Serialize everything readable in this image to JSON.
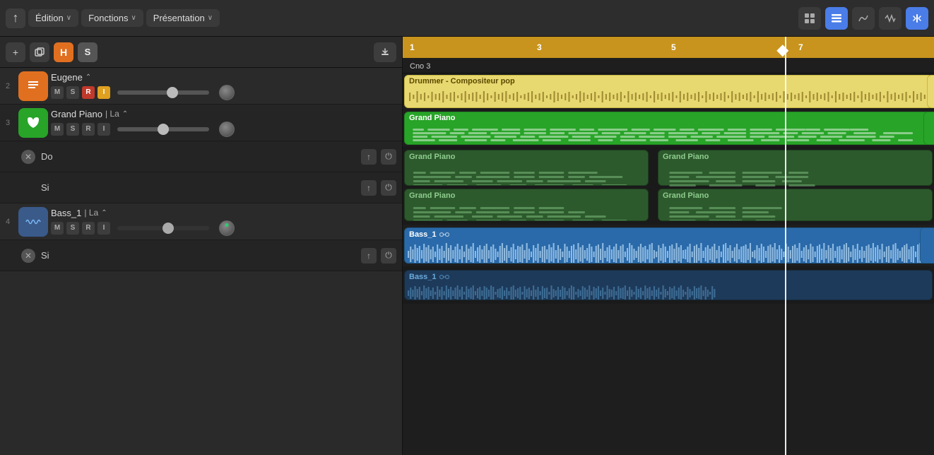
{
  "toolbar": {
    "back_label": "↑",
    "edition_label": "Édition",
    "fonctions_label": "Fonctions",
    "presentation_label": "Présentation",
    "chevron": "∨",
    "icons": {
      "grid": "⊞",
      "list": "≡",
      "curve": "∿",
      "wave": "∿",
      "split": "⊣"
    }
  },
  "track_controls": {
    "add_label": "+",
    "duplicate_label": "⧉",
    "h_label": "H",
    "s_label": "S",
    "import_label": "⬇"
  },
  "tracks": [
    {
      "number": "2",
      "icon_type": "orange",
      "icon_glyph": "♩",
      "name": "Eugene",
      "detail": "",
      "has_chevron": true,
      "controls": [
        "M",
        "S",
        "R",
        "I"
      ],
      "r_active": true,
      "slider_pos": "60%",
      "show_knob": true
    },
    {
      "number": "3",
      "icon_type": "green",
      "icon_glyph": "♪",
      "name": "Grand Piano",
      "detail": "| La",
      "has_chevron": true,
      "controls": [
        "M",
        "S",
        "R",
        "I"
      ],
      "slider_pos": "50%",
      "show_knob": true
    },
    {
      "number": "4",
      "icon_type": "blue-wave",
      "icon_glyph": "≋",
      "name": "Bass_1",
      "detail": "| La",
      "has_chevron": true,
      "controls": [
        "M",
        "S",
        "R",
        "I"
      ],
      "slider_pos": "55%",
      "show_knob": true,
      "knob_green": true
    }
  ],
  "sub_tracks": {
    "track3": [
      {
        "name": "Do",
        "has_close": true
      },
      {
        "name": "Si",
        "has_close": false
      }
    ],
    "track4": [
      {
        "name": "Si",
        "has_close": true
      }
    ]
  },
  "timeline": {
    "numbers": [
      "1",
      "3",
      "5",
      "7"
    ],
    "cno_label": "Cno 3",
    "playhead_pct": "72%"
  },
  "regions": {
    "drummer": {
      "label": "Drummer - Compositeur pop",
      "color": "drummer"
    },
    "grand_piano_main": {
      "label": "Grand Piano",
      "color": "green"
    },
    "grand_piano_sub": [
      {
        "label": "Grand Piano",
        "pos": "top-left"
      },
      {
        "label": "Grand Piano",
        "pos": "top-right"
      },
      {
        "label": "Grand Piano",
        "pos": "bottom-left"
      },
      {
        "label": "Grand Piano",
        "pos": "bottom-right"
      }
    ],
    "bass_main": {
      "label": "Bass_1",
      "color": "blue"
    },
    "bass_sub": {
      "label": "Bass_1",
      "color": "dark-blue"
    }
  },
  "colors": {
    "orange": "#e07020",
    "green_track": "#28a428",
    "blue_track": "#2a6aaa",
    "timeline_gold": "#c8941e",
    "drummer_yellow": "#e8d870",
    "accent_blue": "#4a7de8"
  }
}
